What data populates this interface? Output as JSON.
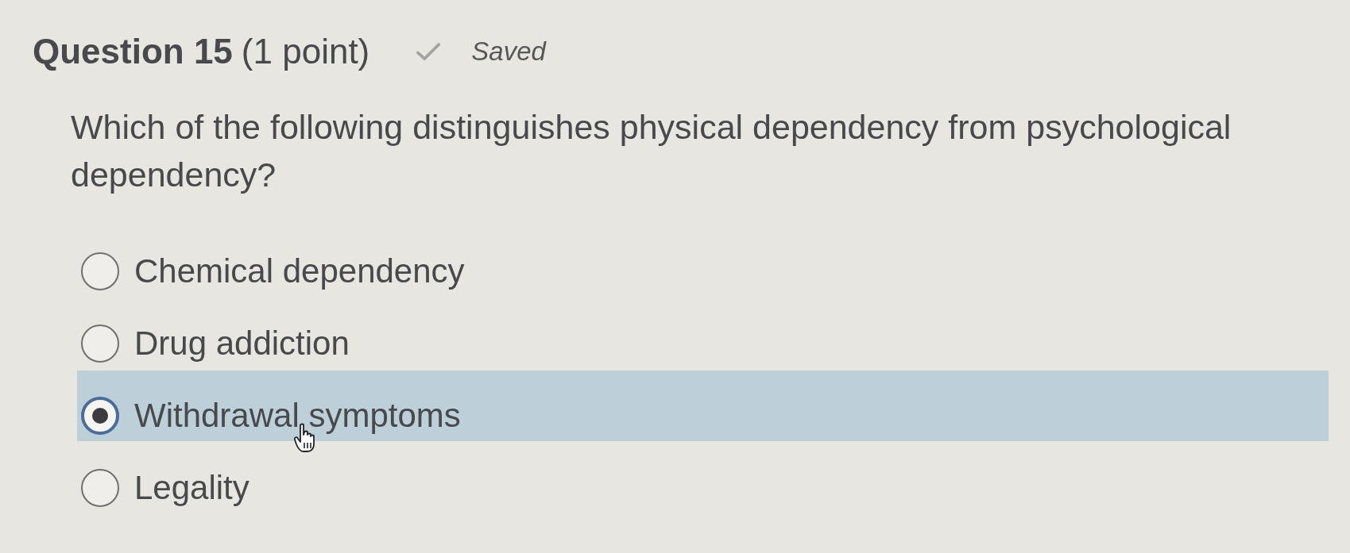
{
  "question": {
    "title": "Question 15",
    "points": "(1 point)",
    "save_status": {
      "saved": true,
      "label": "Saved"
    },
    "prompt": "Which of the following distinguishes physical dependency from psychological dependency?"
  },
  "options": [
    {
      "label": "Chemical dependency",
      "selected": false
    },
    {
      "label": "Drug addiction",
      "selected": false
    },
    {
      "label": "Withdrawal symptoms",
      "selected": true
    },
    {
      "label": "Legality",
      "selected": false
    }
  ]
}
